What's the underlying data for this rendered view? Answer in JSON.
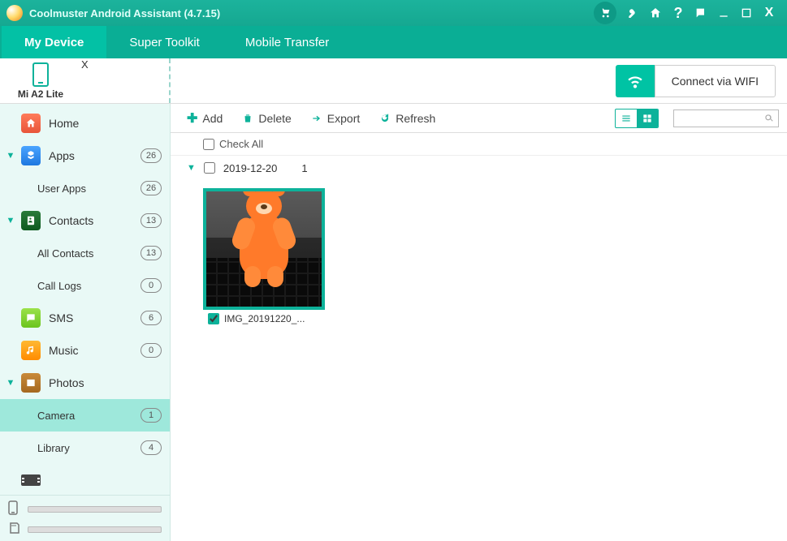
{
  "titlebar": {
    "title": "Coolmuster Android Assistant (4.7.15)"
  },
  "maintabs": {
    "my_device": "My Device",
    "super_toolkit": "Super Toolkit",
    "mobile_transfer": "Mobile Transfer"
  },
  "device": {
    "name": "Mi A2 Lite"
  },
  "wifi": {
    "label": "Connect via WIFI"
  },
  "sidebar": {
    "home": "Home",
    "apps": {
      "label": "Apps",
      "count": "26"
    },
    "user_apps": {
      "label": "User Apps",
      "count": "26"
    },
    "contacts": {
      "label": "Contacts",
      "count": "13"
    },
    "all_contacts": {
      "label": "All Contacts",
      "count": "13"
    },
    "call_logs": {
      "label": "Call Logs",
      "count": "0"
    },
    "sms": {
      "label": "SMS",
      "count": "6"
    },
    "music": {
      "label": "Music",
      "count": "0"
    },
    "photos": {
      "label": "Photos"
    },
    "camera": {
      "label": "Camera",
      "count": "1"
    },
    "library": {
      "label": "Library",
      "count": "4"
    }
  },
  "toolbar": {
    "add": "Add",
    "delete": "Delete",
    "export": "Export",
    "refresh": "Refresh"
  },
  "content": {
    "check_all": "Check All",
    "group_date": "2019-12-20",
    "group_count": "1",
    "thumb_name": "IMG_20191220_..."
  },
  "search": {
    "placeholder": ""
  }
}
